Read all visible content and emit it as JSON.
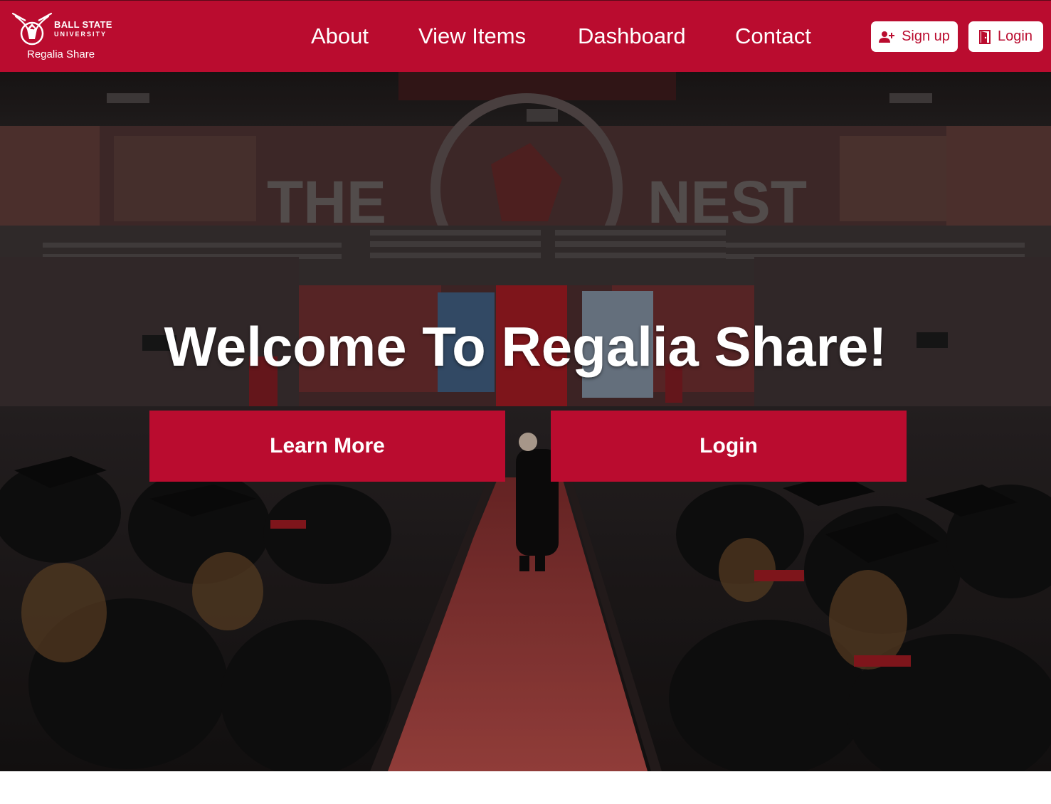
{
  "brand": {
    "logo_name": "ball-state-cardinal-logo",
    "word_line_1": "BALL STATE",
    "word_line_2": "UNIVERSITY",
    "site_name": "Regalia Share"
  },
  "nav": {
    "items": [
      {
        "label": "About"
      },
      {
        "label": "View Items"
      },
      {
        "label": "Dashboard"
      },
      {
        "label": "Contact"
      }
    ]
  },
  "auth": {
    "signup_label": "Sign up",
    "signup_icon": "person-add-icon",
    "login_label": "Login",
    "login_icon": "door-icon"
  },
  "hero": {
    "background": "commencement-ceremony-arena-photo",
    "arena_banner": "THE NEST",
    "title": "Welcome To Regalia Share!",
    "learn_more_label": "Learn More",
    "login_label": "Login"
  },
  "colors": {
    "brand_red": "#ba0c2f",
    "text_on_brand": "#ffffff"
  }
}
